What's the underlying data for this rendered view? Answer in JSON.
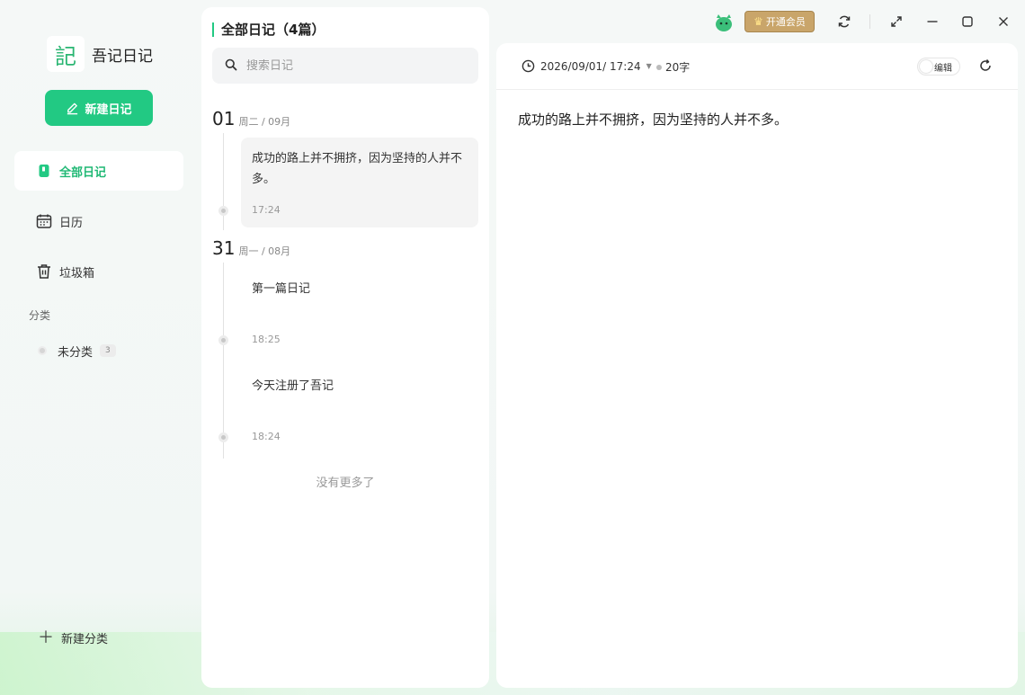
{
  "app": {
    "logo_char": "記",
    "name": "吾记日记"
  },
  "sidebar": {
    "new_button_label": "新建日记",
    "nav": [
      {
        "label": "全部日记",
        "icon": "notebook-icon",
        "active": true
      },
      {
        "label": "日历",
        "icon": "calendar-icon",
        "active": false
      },
      {
        "label": "垃圾箱",
        "icon": "trash-icon",
        "active": false
      }
    ],
    "category_section_title": "分类",
    "categories": [
      {
        "label": "未分类",
        "count": "3"
      }
    ],
    "add_category_label": "新建分类"
  },
  "list": {
    "title": "全部日记（4篇）",
    "search_placeholder": "搜索日记",
    "groups": [
      {
        "day": "01",
        "meta": "周二 / 09月",
        "entries": [
          {
            "text": "成功的路上并不拥挤，因为坚持的人并不多。",
            "time": "17:24",
            "active": true
          }
        ]
      },
      {
        "day": "31",
        "meta": "周一 / 08月",
        "entries": [
          {
            "text": "第一篇日记",
            "time": "18:25",
            "active": false
          },
          {
            "text": "今天注册了吾记",
            "time": "18:24",
            "active": false
          }
        ]
      }
    ],
    "no_more_label": "没有更多了"
  },
  "editor": {
    "datetime": "2026/09/01/ 17:24",
    "word_count": "20字",
    "edit_toggle_label": "编辑",
    "content": "成功的路上并不拥挤，因为坚持的人并不多。"
  },
  "titlebar": {
    "vip_label": "开通会员",
    "icons": [
      "avatar-icon",
      "sync-icon",
      "fullscreen-icon",
      "minimize-icon",
      "maximize-icon",
      "close-icon"
    ]
  },
  "colors": {
    "accent": "#22c983",
    "vip": "#c9a56a"
  }
}
